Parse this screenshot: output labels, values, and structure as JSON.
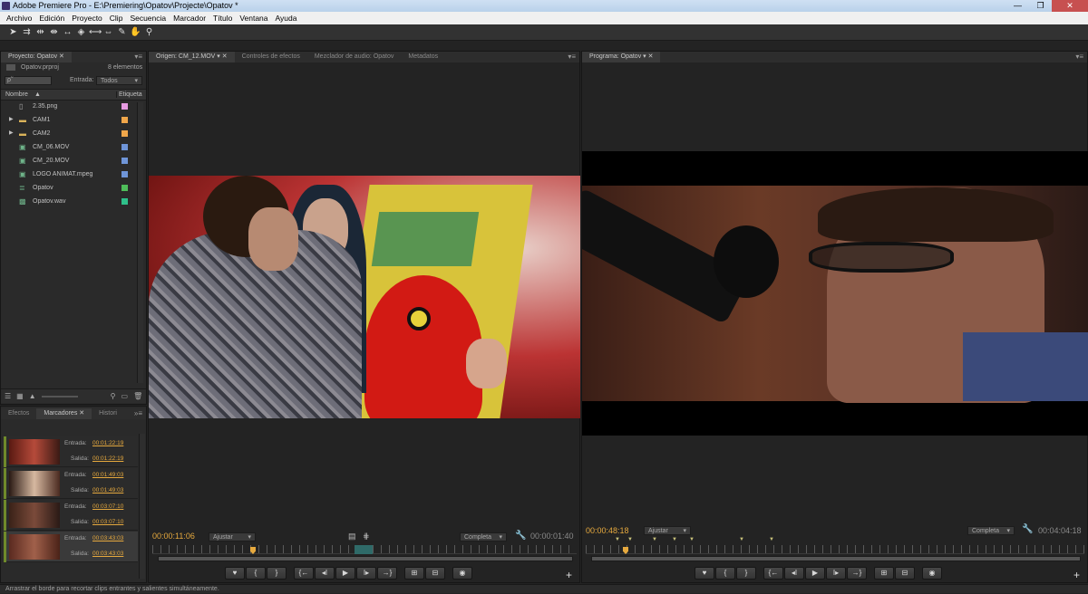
{
  "window": {
    "title": "Adobe Premiere Pro - E:\\Premiering\\Opatov\\Projecte\\Opatov *",
    "controls": [
      "—",
      "❐",
      "✕"
    ]
  },
  "menu": [
    "Archivo",
    "Edición",
    "Proyecto",
    "Clip",
    "Secuencia",
    "Marcador",
    "Título",
    "Ventana",
    "Ayuda"
  ],
  "tools": [
    "selection-tool",
    "track-select-tool",
    "ripple-edit-tool",
    "rolling-edit-tool",
    "rate-stretch-tool",
    "razor-tool",
    "slip-tool",
    "slide-tool",
    "pen-tool",
    "hand-tool",
    "zoom-tool"
  ],
  "project": {
    "tab": "Proyecto: Opatov",
    "file": "Opatov.prproj",
    "count": "8 elementos",
    "search_placeholder": "ρ˜",
    "entrada_label": "Entrada:",
    "entrada_value": "Todos",
    "col_name": "Nombre",
    "col_label": "Etiqueta",
    "items": [
      {
        "name": "2.35.png",
        "icon": "image-file-icon",
        "color": "#e79be1"
      },
      {
        "name": "CAM1",
        "icon": "folder-icon",
        "color": "#f0a64a",
        "folder": true
      },
      {
        "name": "CAM2",
        "icon": "folder-icon",
        "color": "#f0a64a",
        "folder": true
      },
      {
        "name": "CM_06.MOV",
        "icon": "video-clip-icon",
        "color": "#6f95d8"
      },
      {
        "name": "CM_20.MOV",
        "icon": "video-clip-icon",
        "color": "#6f95d8"
      },
      {
        "name": "LOGO ANIMAT.mpeg",
        "icon": "video-clip-icon",
        "color": "#6f95d8"
      },
      {
        "name": "Opatov",
        "icon": "sequence-icon",
        "color": "#4fbd5a"
      },
      {
        "name": "Opatov.wav",
        "icon": "audio-file-icon",
        "color": "#2fc08a"
      }
    ]
  },
  "markers_panel": {
    "tabs": [
      "Efectos",
      "Marcadores",
      "Histori"
    ],
    "entrada_label": "Entrada:",
    "salida_label": "Salida:",
    "items": [
      {
        "in": "00:01:22:19",
        "out": "00:01:22:19"
      },
      {
        "in": "00:01:49:03",
        "out": "00:01:49:03"
      },
      {
        "in": "00:03:07:10",
        "out": "00:03:07:10"
      },
      {
        "in": "00:03:43:03",
        "out": "00:03:43:03"
      }
    ]
  },
  "source": {
    "tabs": [
      "Origen: CM_12.MOV",
      "Controles de efectos",
      "Mezclador de audio: Opatov",
      "Metadatos"
    ],
    "timecode": "00:00:11:06",
    "fit": "Ajustar",
    "quality": "Completa",
    "duration": "00:00:01:40"
  },
  "program": {
    "tab": "Programa: Opatov",
    "timecode": "00:00:48:18",
    "fit": "Ajustar",
    "quality": "Completa",
    "duration": "00:04:04:18"
  },
  "status": "Arrastrar el borde para recortar clips entrantes y salientes simultáneamente."
}
